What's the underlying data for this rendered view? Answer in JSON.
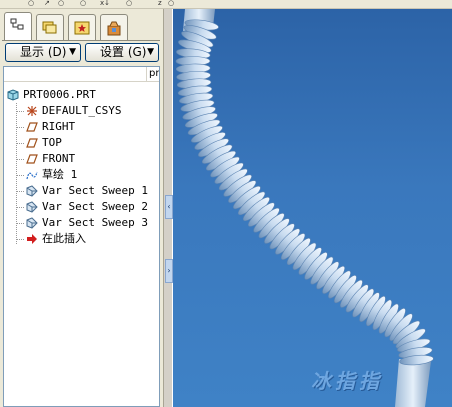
{
  "toolbar_strip": [
    "○",
    "↗",
    "○",
    "○",
    "x↓",
    "○",
    "z",
    "○"
  ],
  "navigator": {
    "tabs": [
      "model-tree-icon",
      "layers-icon",
      "favorites-icon",
      "explorer-icon"
    ],
    "show_menu": "显示 (D)",
    "settings_menu": "设置 (G)",
    "column_header": "prt"
  },
  "tree": {
    "root": "PRT0006.PRT",
    "items": [
      {
        "icon": "csys-icon",
        "label": "DEFAULT_CSYS"
      },
      {
        "icon": "datum-plane-icon",
        "label": "RIGHT"
      },
      {
        "icon": "datum-plane-icon",
        "label": "TOP"
      },
      {
        "icon": "datum-plane-icon",
        "label": "FRONT"
      },
      {
        "icon": "sketch-icon",
        "label": "草绘 1"
      },
      {
        "icon": "sweep-icon",
        "label": "Var Sect Sweep 1"
      },
      {
        "icon": "sweep-icon",
        "label": "Var Sect Sweep 2"
      },
      {
        "icon": "sweep-icon",
        "label": "Var Sect Sweep 3"
      },
      {
        "icon": "insert-here-arrow-icon",
        "label": "在此插入"
      }
    ]
  },
  "graphics": {
    "background": "#3a78bd",
    "model_color": "#c9dcf0",
    "watermark": "冰指指"
  }
}
